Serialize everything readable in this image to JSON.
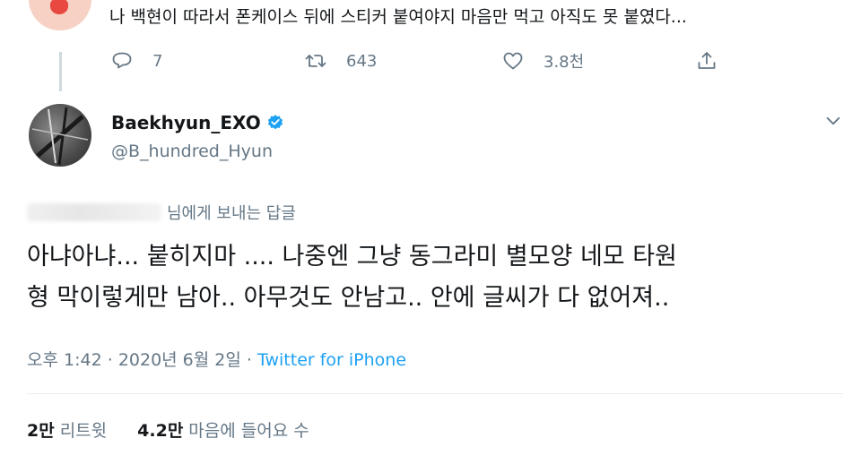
{
  "previous_tweet": {
    "avatar_icon": "strawberry-avatar-icon",
    "text": "나 백현이 따라서 폰케이스 뒤에 스티커 붙여야지 마음만 먹고 아직도 못 붙였다...",
    "reply_count": "7",
    "retweet_count": "643",
    "like_count": "3.8천"
  },
  "tweet": {
    "display_name": "Baekhyun_EXO",
    "handle": "@B_hundred_Hyun",
    "verified": true,
    "reply_to_suffix": "님에게 보내는 답글",
    "body": "아냐아냐... 붙히지마 .... 나중엔 그냥 동그라미 별모양 네모 타원\n형 막이렇게만 남아.. 아무것도 안남고.. 안에 글씨가 다 없어져..",
    "time": "오후 1:42",
    "date": "2020년 6월 2일",
    "separator": "·",
    "source": "Twitter for iPhone",
    "retweets_value": "2만",
    "retweets_label": "리트윗",
    "likes_value": "4.2만",
    "likes_label": "마음에 들어요 수"
  },
  "colors": {
    "accent": "#1da1f2",
    "secondary_text": "#657786",
    "primary_text": "#14171a"
  }
}
